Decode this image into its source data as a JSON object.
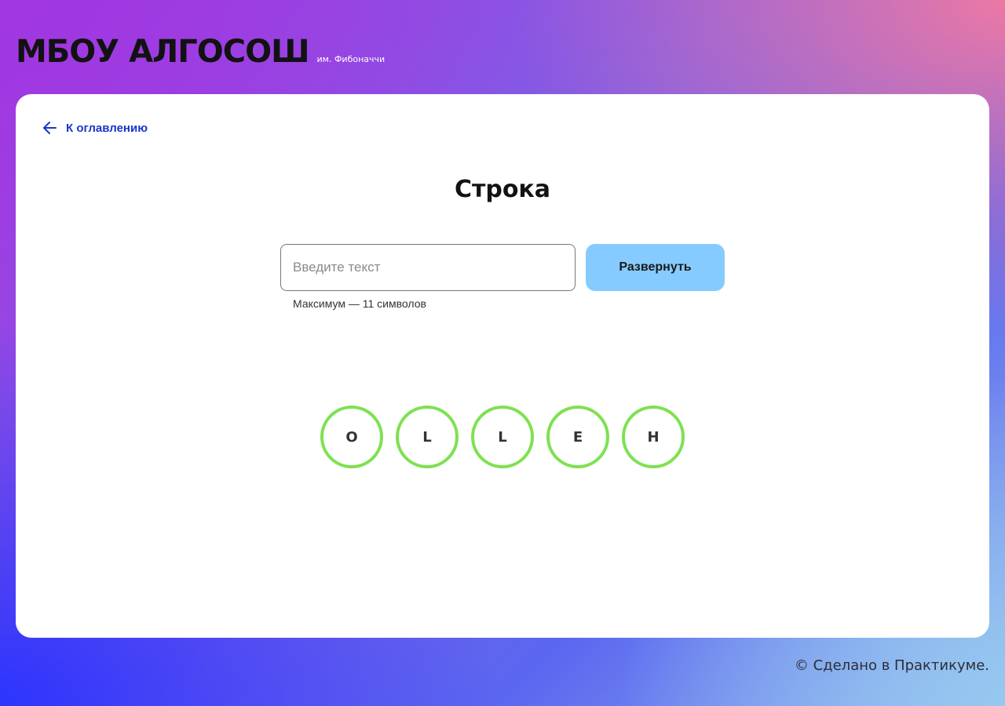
{
  "header": {
    "logo": "МБОУ АЛГОСОШ",
    "subtitle": "им. Фибоначчи"
  },
  "nav": {
    "back_label": "К оглавлению",
    "back_icon": "arrow-left-icon"
  },
  "page": {
    "title": "Строка"
  },
  "form": {
    "input_value": "",
    "input_placeholder": "Введите текст",
    "hint": "Максимум — 11 символов",
    "button_label": "Развернуть",
    "button_color": "#86cbff"
  },
  "result": {
    "circle_border_color": "#7ee150",
    "letters": [
      "O",
      "L",
      "L",
      "E",
      "H"
    ]
  },
  "footer": {
    "text": "© Сделано в Практикуме."
  }
}
